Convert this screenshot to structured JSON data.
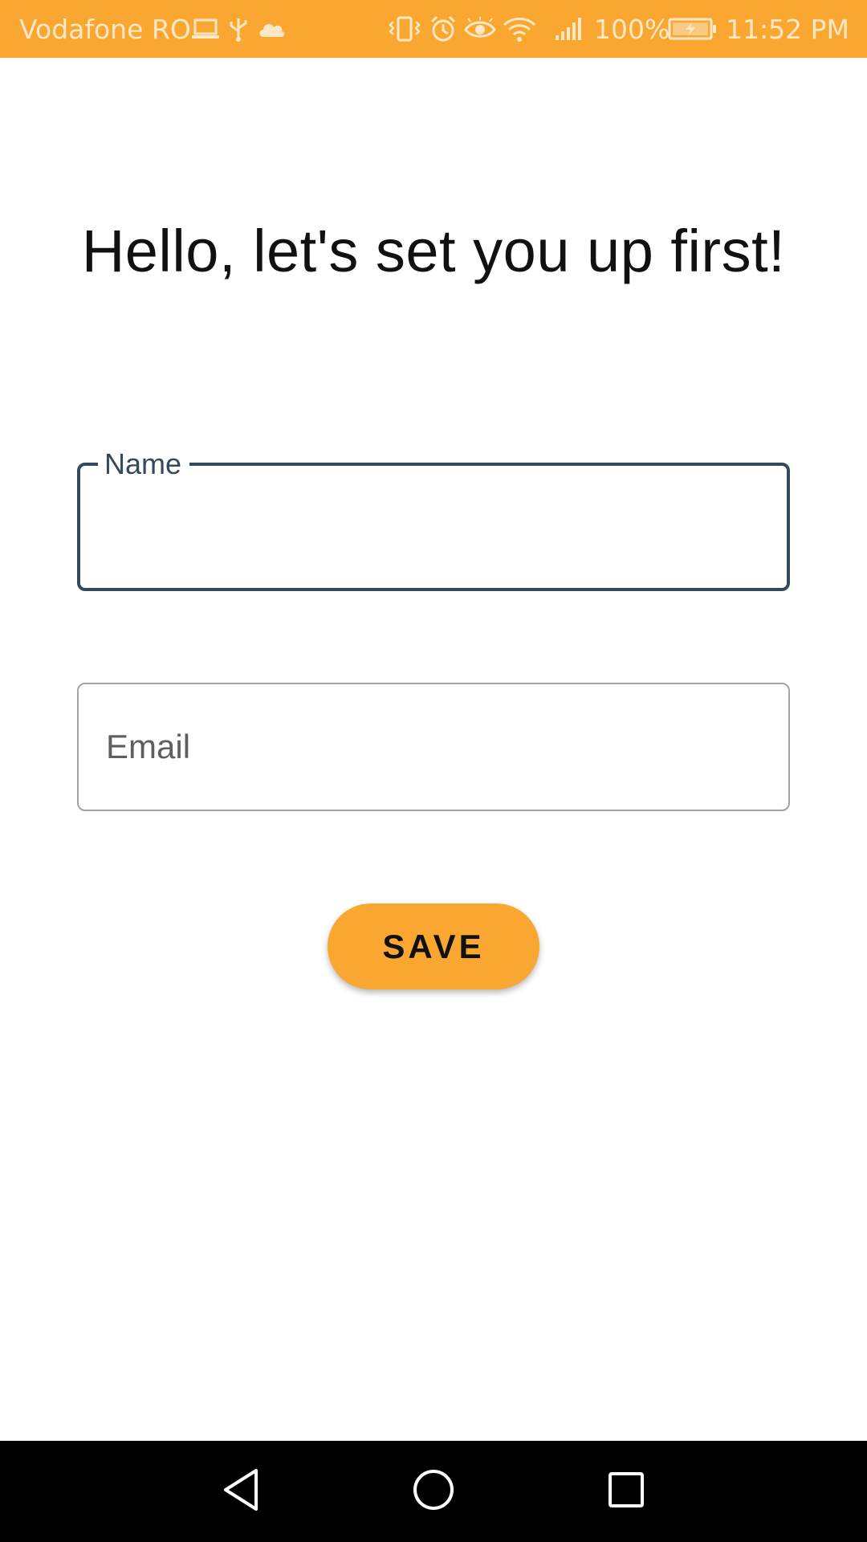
{
  "status_bar": {
    "carrier": "Vodafone RO",
    "battery": "100%",
    "time": "11:52 PM",
    "icons": [
      "laptop-icon",
      "usb-icon",
      "cloud-icon",
      "vibrate-icon",
      "alarm-icon",
      "eye-icon",
      "wifi-icon",
      "signal-icon",
      "battery-charging-icon"
    ],
    "background_color": "#f9a731"
  },
  "main": {
    "title": "Hello, let's set you up first!",
    "name_field": {
      "label": "Name",
      "value": ""
    },
    "email_field": {
      "placeholder": "Email",
      "value": ""
    },
    "save_label": "SAVE"
  },
  "nav_bar": {
    "icons": [
      "back-icon",
      "home-icon",
      "recent-apps-icon"
    ]
  },
  "colors": {
    "accent": "#f9a731",
    "focused_outline": "#344a5c",
    "idle_outline": "#a2a2a2"
  }
}
